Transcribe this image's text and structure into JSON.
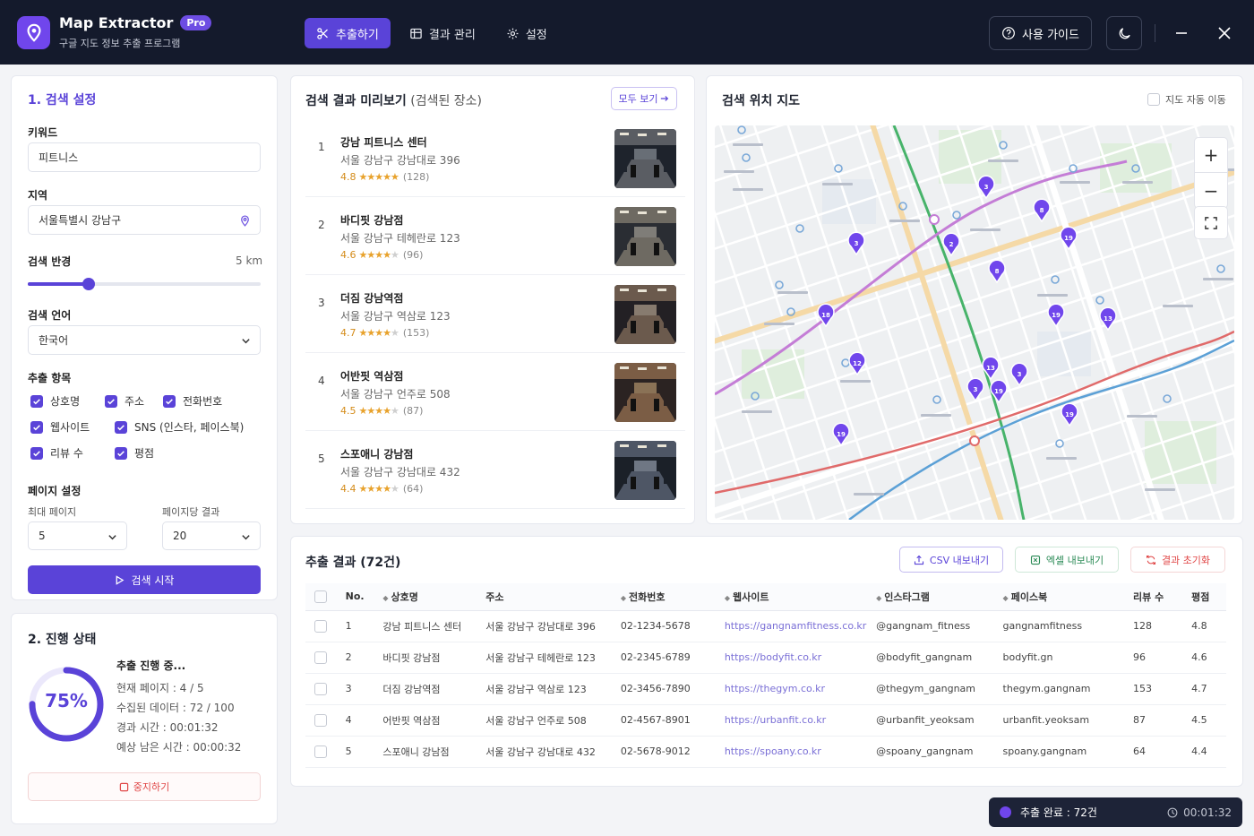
{
  "app": {
    "name": "Map Extractor",
    "badge": "Pro",
    "subtitle": "구글 지도 정보 추출 프로그램"
  },
  "nav": [
    {
      "label": "추출하기",
      "icon": "scissors-icon",
      "active": true
    },
    {
      "label": "결과 관리",
      "icon": "table-icon",
      "active": false
    },
    {
      "label": "설정",
      "icon": "gear-icon",
      "active": false
    }
  ],
  "header": {
    "guide_label": "사용 가이드"
  },
  "search": {
    "title": "1. 검색 설정",
    "keyword_label": "키워드",
    "keyword_value": "피트니스",
    "region_label": "지역",
    "region_value": "서울특별시 강남구",
    "radius_label": "검색 반경",
    "radius_value": "5 km",
    "radius_fraction": 0.26,
    "lang_label": "검색 언어",
    "lang_value": "한국어",
    "fields_label": "추출 항목",
    "fields": [
      "상호명",
      "주소",
      "전화번호",
      "웹사이트",
      "SNS (인스타, 페이스북)",
      "리뷰 수",
      "평점"
    ],
    "page_label": "페이지 설정",
    "max_page_label": "최대 페이지",
    "max_page_value": "5",
    "per_page_label": "페이지당 결과",
    "per_page_value": "20",
    "start_label": "검색 시작"
  },
  "progress": {
    "title": "2. 진행 상태",
    "percent_text": "75%",
    "percent": 75,
    "status": "추출 진행 중...",
    "current_page": "현재 페이지 : 4 / 5",
    "collected": "수집된 데이터 : 72 / 100",
    "elapsed": "경과 시간 : 00:01:32",
    "remaining": "예상 남은 시간 : 00:00:32",
    "stop_label": "중지하기"
  },
  "preview": {
    "title": "검색 결과 미리보기",
    "title_sub": "(검색된 장소)",
    "more_label": "모두 보기",
    "items": [
      {
        "num": "1",
        "name": "강남 피트니스 센터",
        "addr": "서울 강남구 강남대로 396",
        "rating": "4.8",
        "stars": 5,
        "count": "(128)"
      },
      {
        "num": "2",
        "name": "바디핏 강남점",
        "addr": "서울 강남구 테헤란로 123",
        "rating": "4.6",
        "stars": 4,
        "count": "(96)"
      },
      {
        "num": "3",
        "name": "더짐 강남역점",
        "addr": "서울 강남구 역삼로 123",
        "rating": "4.7",
        "stars": 4,
        "count": "(153)"
      },
      {
        "num": "4",
        "name": "어반핏 역삼점",
        "addr": "서울 강남구 언주로 508",
        "rating": "4.5",
        "stars": 4,
        "count": "(87)"
      },
      {
        "num": "5",
        "name": "스포애니 강남점",
        "addr": "서울 강남구 강남대로 432",
        "rating": "4.4",
        "stars": 4,
        "count": "(64)"
      }
    ]
  },
  "map": {
    "title": "검색 위치 지도",
    "auto_move_label": "지도 자동 이동",
    "zoom_in": "+",
    "zoom_out": "−",
    "accent": "#7046ec",
    "pins": [
      "3",
      "8",
      "19",
      "3",
      "2",
      "8",
      "18",
      "19",
      "13",
      "12",
      "13",
      "3",
      "3",
      "19",
      "19",
      "19"
    ]
  },
  "results": {
    "title": "추출 결과 (72건)",
    "csv_label": "CSV 내보내기",
    "excel_label": "엑셀 내보내기",
    "reset_label": "결과 초기화",
    "columns": [
      "No.",
      "상호명",
      "주소",
      "전화번호",
      "웹사이트",
      "인스타그램",
      "페이스북",
      "리뷰 수",
      "평점"
    ],
    "rows": [
      [
        "1",
        "강남 피트니스 센터",
        "서울 강남구 강남대로 396",
        "02-1234-5678",
        "https://gangnamfitness.co.kr",
        "@gangnam_fitness",
        "gangnamfitness",
        "128",
        "4.8"
      ],
      [
        "2",
        "바디핏 강남점",
        "서울 강남구 테헤란로 123",
        "02-2345-6789",
        "https://bodyfit.co.kr",
        "@bodyfit_gangnam",
        "bodyfit.gn",
        "96",
        "4.6"
      ],
      [
        "3",
        "더짐 강남역점",
        "서울 강남구 역삼로 123",
        "02-3456-7890",
        "https://thegym.co.kr",
        "@thegym_gangnam",
        "thegym.gangnam",
        "153",
        "4.7"
      ],
      [
        "4",
        "어반핏 역삼점",
        "서울 강남구 언주로 508",
        "02-4567-8901",
        "https://urbanfit.co.kr",
        "@urbanfit_yeoksam",
        "urbanfit.yeoksam",
        "87",
        "4.5"
      ],
      [
        "5",
        "스포애니 강남점",
        "서울 강남구 강남대로 432",
        "02-5678-9012",
        "https://spoany.co.kr",
        "@spoany_gangnam",
        "spoany.gangnam",
        "64",
        "4.4"
      ]
    ]
  },
  "toast": {
    "text": "추출 완료 : 72건",
    "time": "00:01:32"
  }
}
